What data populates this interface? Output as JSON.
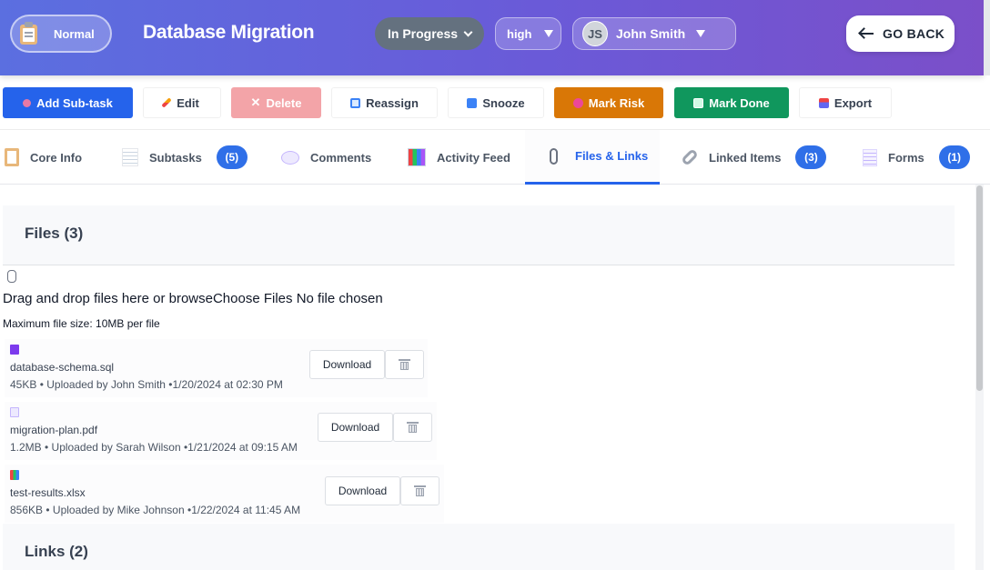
{
  "header": {
    "type_label": "Normal",
    "title": "Database Migration",
    "status": "In Progress",
    "priority": "high",
    "assignee_initials": "JS",
    "assignee_name": "John Smith",
    "go_back_label": "GO BACK",
    "colors": {
      "gradient_start": "#5b6fe0",
      "gradient_end": "#7b4fc9",
      "status_pill": "#64717f"
    }
  },
  "toolbar": {
    "add_subtask": "Add Sub-task",
    "edit": "Edit",
    "delete": "Delete",
    "reassign": "Reassign",
    "snooze": "Snooze",
    "mark_risk": "Mark Risk",
    "mark_done": "Mark Done",
    "export": "Export",
    "colors": {
      "add": "#2563eb",
      "delete": "#f3a4a8",
      "risk": "#d97706",
      "done": "#10975d"
    }
  },
  "tabs": [
    {
      "label": "Core Info",
      "icon": "clipboard-icon"
    },
    {
      "label": "Subtasks",
      "icon": "memo-icon",
      "badge": "(5)"
    },
    {
      "label": "Comments",
      "icon": "speech-bubble-icon"
    },
    {
      "label": "Activity Feed",
      "icon": "bar-chart-icon"
    },
    {
      "label": "Files & Links",
      "icon": "paperclip-icon",
      "active": true
    },
    {
      "label": "Linked Items",
      "icon": "link-icon",
      "badge": "(3)"
    },
    {
      "label": "Forms",
      "icon": "document-icon",
      "badge": "(1)"
    }
  ],
  "files": {
    "heading": "Files (3)",
    "drop_text": "Drag and drop files here or browse",
    "choose_files": "Choose Files",
    "no_file": "No file chosen",
    "max_size": "Maximum file size: 10MB per file",
    "download_label": "Download",
    "items": [
      {
        "name": "database-schema.sql",
        "meta": "45KB • Uploaded by John Smith •1/20/2024 at 02:30 PM",
        "icon": "database-icon"
      },
      {
        "name": "migration-plan.pdf",
        "meta": "1.2MB • Uploaded by Sarah Wilson •1/21/2024 at 09:15 AM",
        "icon": "pdf-icon"
      },
      {
        "name": "test-results.xlsx",
        "meta": "856KB • Uploaded by Mike Johnson •1/22/2024 at 11:45 AM",
        "icon": "spreadsheet-icon"
      }
    ]
  },
  "links": {
    "heading": "Links (2)"
  }
}
